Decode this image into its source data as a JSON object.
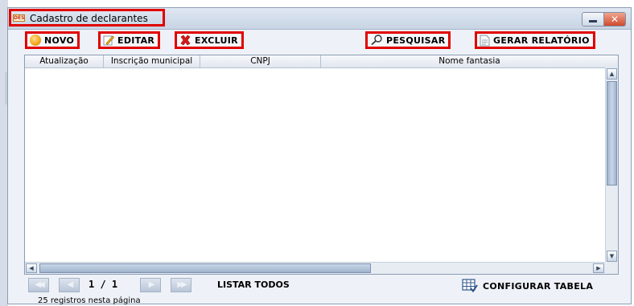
{
  "window": {
    "title": "Cadastro de declarantes",
    "app_icon_text": "DES",
    "close_symbol": "✕"
  },
  "toolbar": {
    "novo_label": "NOVO",
    "editar_label": "EDITAR",
    "excluir_label": "EXCLUIR",
    "pesquisar_label": "PESQUISAR",
    "gerar_relatorio_label": "GERAR RELATÓRIO"
  },
  "grid": {
    "columns": [
      "Atualização",
      "Inscrição municipal",
      "CNPJ",
      "Nome fantasia"
    ],
    "rows": []
  },
  "pager": {
    "page_info": "1 / 1",
    "listar_todos_label": "LISTAR TODOS",
    "configurar_tabela_label": "CONFIGURAR TABELA",
    "records_text": "25 registros nesta página"
  },
  "colors": {
    "highlight": "#e00000",
    "accent": "#4a6fa5"
  },
  "icons": [
    "app-icon",
    "novo-icon",
    "edit-icon",
    "delete-icon",
    "search-icon",
    "report-icon",
    "table-config-icon"
  ]
}
